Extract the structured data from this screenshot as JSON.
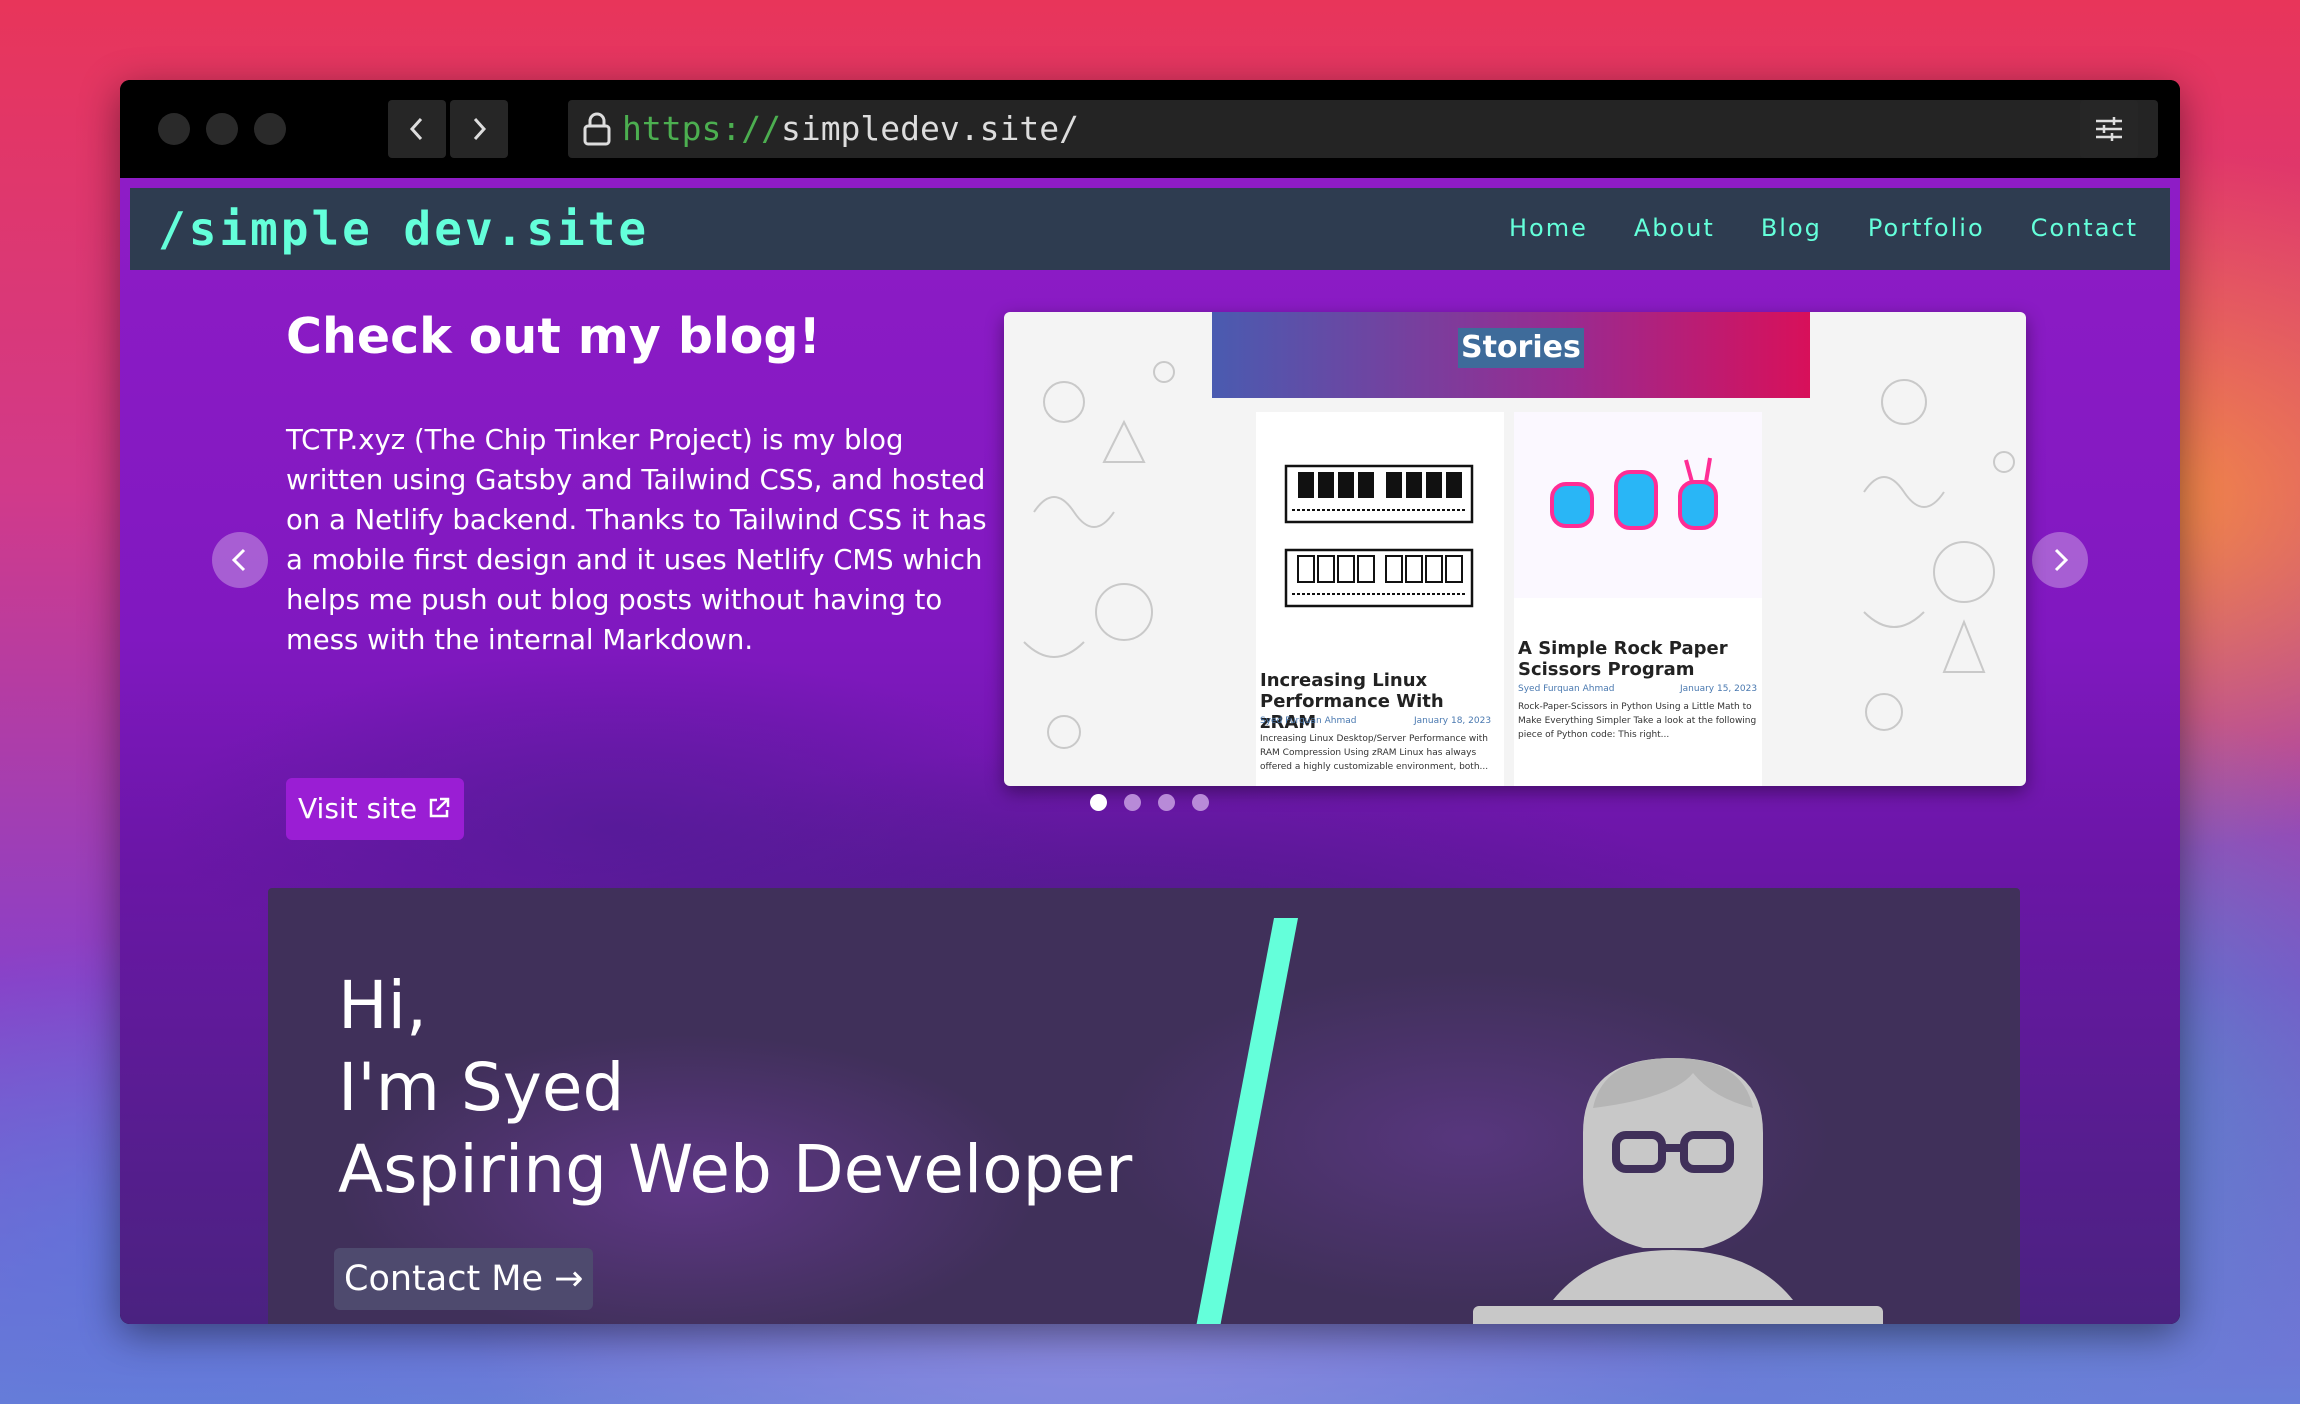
{
  "browser": {
    "url_protocol": "https://",
    "url_rest": "simpledev.site/",
    "back_label": "‹",
    "forward_label": "›"
  },
  "site": {
    "brand": "/simple dev.site",
    "nav": [
      "Home",
      "About",
      "Blog",
      "Portfolio",
      "Contact"
    ]
  },
  "carousel": {
    "title": "Check out my blog!",
    "description": "TCTP.xyz (The Chip Tinker Project) is my blog written using Gatsby and Tailwind CSS, and hosted on a Netlify backend. Thanks to Tailwind CSS it has a mobile first design and it uses Netlify CMS which helps me push out blog posts without having to mess with the internal Markdown.",
    "button_label": "Visit site",
    "slides_count": 4,
    "active_slide": 1,
    "preview": {
      "heading": "Stories",
      "cards": [
        {
          "title": "Increasing Linux Performance With zRAM",
          "author": "Syed Furquan Ahmad",
          "date": "January 18, 2023",
          "excerpt": "Increasing Linux Desktop/Server Performance with RAM Compression Using zRAM Linux has always offered a highly customizable environment, both..."
        },
        {
          "title": "A Simple Rock Paper Scissors Program",
          "author": "Syed Furquan Ahmad",
          "date": "January 15, 2023",
          "excerpt": "Rock-Paper-Scissors in Python Using a Little Math to Make Everything Simpler Take a look at the following piece of Python code: This right..."
        }
      ]
    }
  },
  "hero": {
    "line1": "Hi,",
    "line2": "I'm Syed",
    "line3": "Aspiring Web Developer",
    "contact_label": "Contact Me →"
  },
  "colors": {
    "accent": "#64ffda",
    "nav_bg": "#2e3c50",
    "page_bg": "#8e1cc6",
    "hero_bg": "#40305a"
  }
}
